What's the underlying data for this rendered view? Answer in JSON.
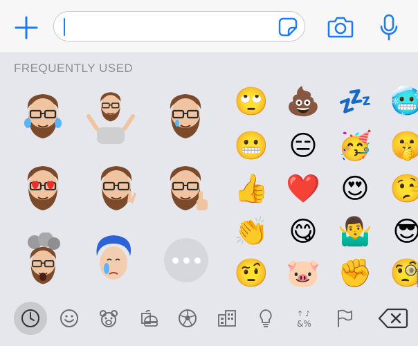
{
  "input_bar": {
    "text_value": "",
    "plus_icon": "plus-icon",
    "sticker_icon": "sticker-icon",
    "camera_icon": "camera-icon",
    "mic_icon": "microphone-icon"
  },
  "section": {
    "title": "FREQUENTLY USED"
  },
  "memoji": [
    "memoji-laughing-tears",
    "memoji-shrugging",
    "memoji-crying",
    "memoji-heart-eyes",
    "memoji-crossed-fingers",
    "memoji-thumbs-up",
    "memoji-mind-blown",
    "memoji-blue-hair-crying"
  ],
  "emoji": [
    "🙄",
    "💩",
    "💤",
    "🥶",
    "😬",
    "😑",
    "🥳",
    "🤫",
    "👍",
    "❤️",
    "😍",
    "🤥",
    "👏",
    "😋",
    "🤷‍♂️",
    "😎",
    "🤨",
    "🐷",
    "✊",
    "🧐"
  ],
  "more_button": {
    "icon": "ellipsis-icon"
  },
  "categories": [
    {
      "name": "recents",
      "icon": "clock-icon",
      "active": true
    },
    {
      "name": "smileys",
      "icon": "smiley-icon",
      "active": false
    },
    {
      "name": "animals",
      "icon": "bear-icon",
      "active": false
    },
    {
      "name": "food",
      "icon": "burger-icon",
      "active": false
    },
    {
      "name": "activity",
      "icon": "soccer-ball-icon",
      "active": false
    },
    {
      "name": "travel",
      "icon": "buildings-icon",
      "active": false
    },
    {
      "name": "objects",
      "icon": "lightbulb-icon",
      "active": false
    },
    {
      "name": "symbols",
      "icon": "symbols-icon",
      "active": false
    },
    {
      "name": "flags",
      "icon": "flag-icon",
      "active": false
    }
  ],
  "delete_icon": "backspace-icon",
  "colors": {
    "accent": "#1f7bf2",
    "label": "#8e8e93",
    "icon_gray": "#6b6b70",
    "keyboard_bg": "#e6e7ec"
  }
}
